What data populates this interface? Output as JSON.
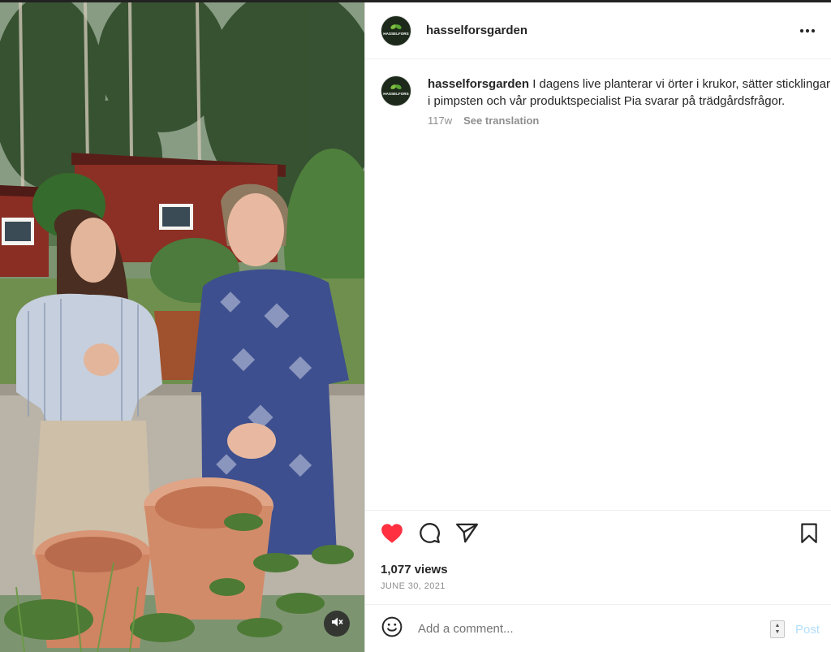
{
  "post": {
    "username": "hasselforsgarden",
    "avatar_logo_text": "HASSELFORS",
    "caption": {
      "username": "hasselforsgarden",
      "text": "I dagens live planterar vi örter i krukor, sätter sticklingar i pimpsten och vår produktspecialist Pia svarar på trädgårdsfrågor.",
      "age": "117w",
      "see_translation": "See translation"
    },
    "views": "1,077 views",
    "date": "JUNE 30, 2021",
    "liked": true
  },
  "comment_box": {
    "placeholder": "Add a comment...",
    "post_label": "Post"
  },
  "icons": {
    "more": "more-horizontal-icon",
    "like": "heart-filled-icon",
    "comment": "comment-bubble-icon",
    "share": "paper-plane-icon",
    "save": "bookmark-icon",
    "emoji": "emoji-smile-icon",
    "mute": "speaker-muted-icon"
  },
  "colors": {
    "like_red": "#ff3040",
    "post_disabled_blue": "#b2dffc",
    "text_primary": "#262626",
    "text_secondary": "#8e8e8e"
  }
}
